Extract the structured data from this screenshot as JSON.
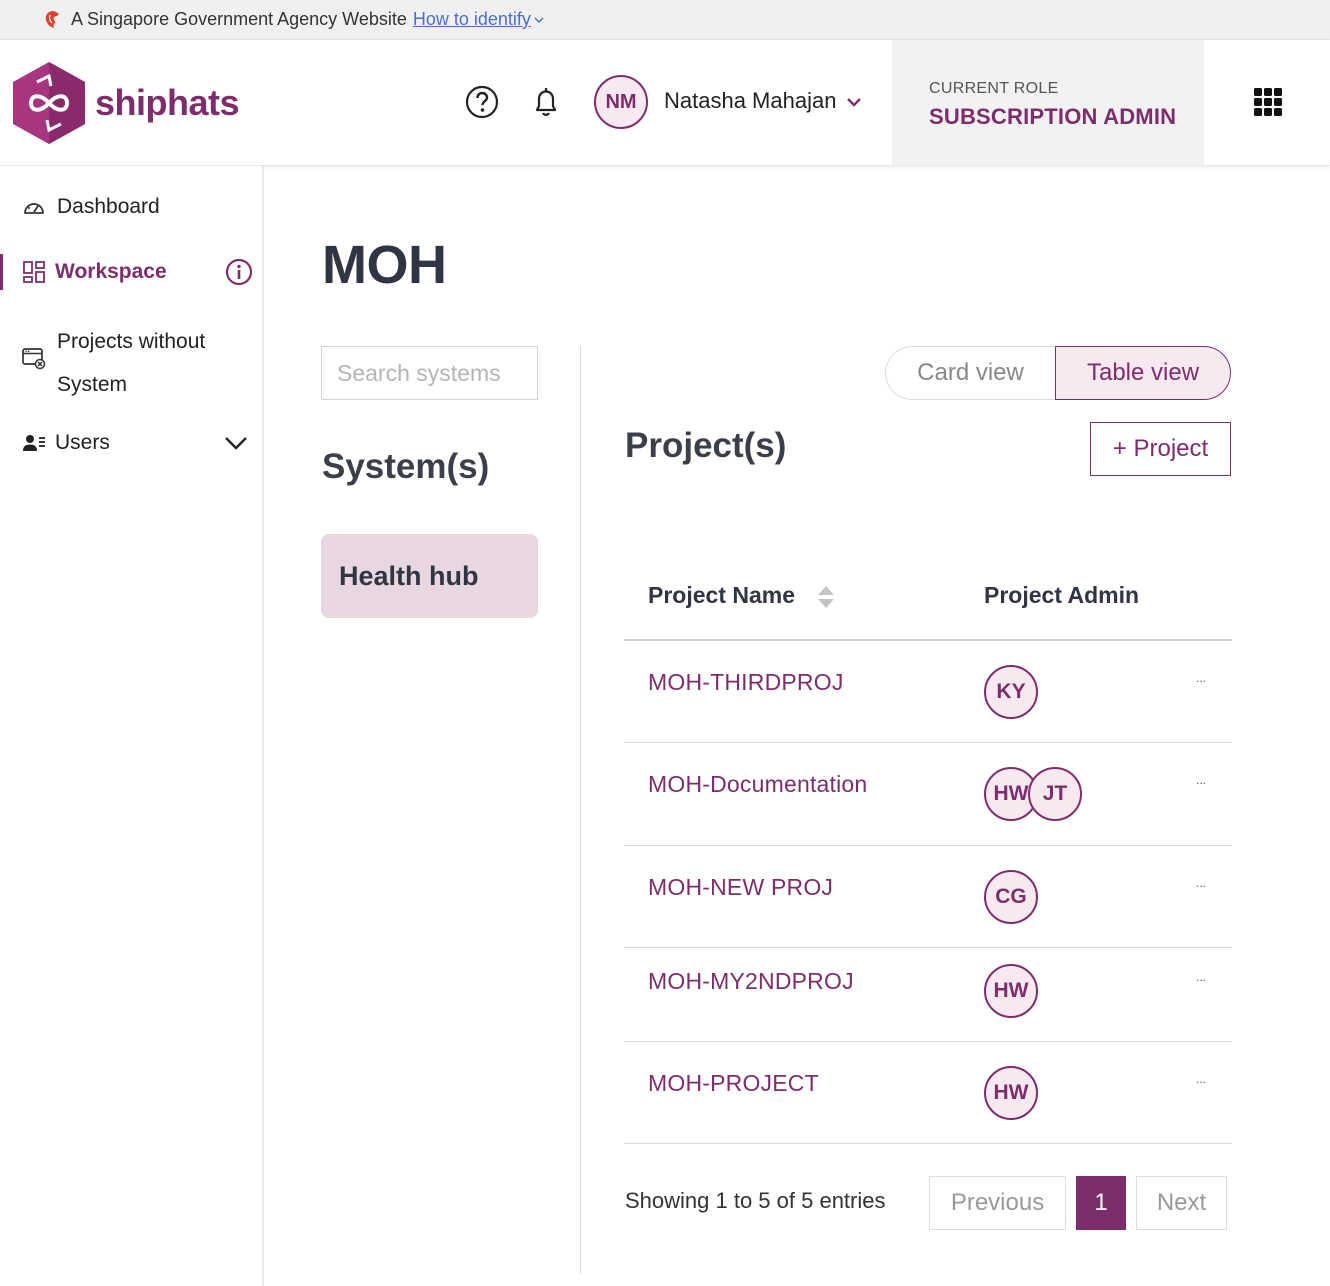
{
  "masthead": {
    "text": "A Singapore Government Agency Website",
    "link": "How to identify"
  },
  "header": {
    "logo_text": "shiphats",
    "user_initials": "NM",
    "user_name": "Natasha Mahajan",
    "role_label": "CURRENT ROLE",
    "role_value": "SUBSCRIPTION ADMIN"
  },
  "sidebar": {
    "items": [
      {
        "label": "Dashboard",
        "icon": "dashboard-icon"
      },
      {
        "label": "Workspace",
        "icon": "workspace-icon"
      },
      {
        "label": "Projects without System",
        "icon": "projects-without-system-icon"
      },
      {
        "label": "Users",
        "icon": "users-icon"
      }
    ]
  },
  "main": {
    "title": "MOH",
    "search_placeholder": "Search systems",
    "systems_heading": "System(s)",
    "systems": [
      {
        "name": "Health hub"
      }
    ],
    "view_toggle": {
      "card": "Card view",
      "table": "Table view",
      "active": "table"
    },
    "projects_heading": "Project(s)",
    "add_project_label": "+ Project",
    "table": {
      "columns": [
        "Project Name",
        "Project Admin"
      ],
      "rows": [
        {
          "name": "MOH-THIRDPROJ",
          "admins": [
            "KY"
          ]
        },
        {
          "name": "MOH-Documentation",
          "admins": [
            "HW",
            "JT"
          ]
        },
        {
          "name": "MOH-NEW PROJ",
          "admins": [
            "CG"
          ]
        },
        {
          "name": "MOH-MY2NDPROJ",
          "admins": [
            "HW"
          ]
        },
        {
          "name": "MOH-PROJECT",
          "admins": [
            "HW"
          ]
        }
      ],
      "more_label": "..."
    },
    "pagination": {
      "summary": "Showing 1 to 5 of 5 entries",
      "previous": "Previous",
      "current": "1",
      "next": "Next"
    }
  },
  "colors": {
    "brand": "#7e2d6c",
    "brand_light": "#f8e9f1",
    "system_card": "#e8d6e1"
  }
}
